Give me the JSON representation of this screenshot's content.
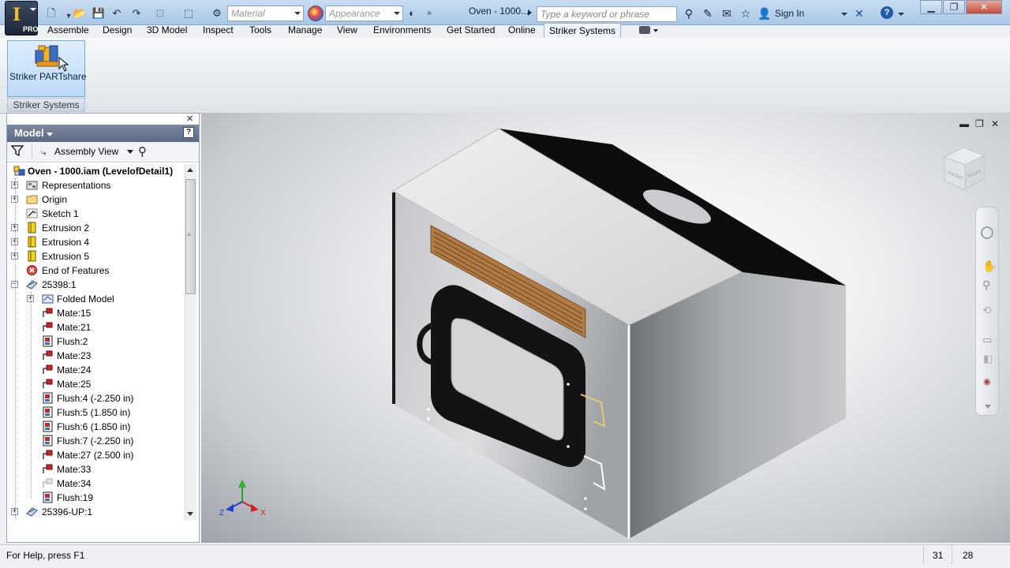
{
  "quick_access": {
    "material_placeholder": "Material",
    "appearance_placeholder": "Appearance",
    "app_pro_label": "PRO"
  },
  "titlebar": {
    "document_title": "Oven - 1000...",
    "search_placeholder": "Type a keyword or phrase",
    "sign_in": "Sign In"
  },
  "menu": {
    "items": [
      "Assemble",
      "Design",
      "3D Model",
      "Inspect",
      "Tools",
      "Manage",
      "View",
      "Environments",
      "Get Started",
      "Online",
      "Striker Systems"
    ],
    "active": "Striker Systems"
  },
  "ribbon": {
    "button_label": "Striker PARTshare",
    "panel_label": "Striker Systems"
  },
  "browser": {
    "title": "Model",
    "view_mode": "Assembly View",
    "help": "?",
    "close": "✕",
    "tree": [
      {
        "label": "Oven - 1000.iam (LevelofDetail1)",
        "level": 0,
        "expander": "",
        "icon": "assembly-icon",
        "bold": true
      },
      {
        "label": "Representations",
        "level": 1,
        "expander": "+",
        "icon": "representations-icon"
      },
      {
        "label": "Origin",
        "level": 1,
        "expander": "+",
        "icon": "folder-icon"
      },
      {
        "label": "Sketch 1",
        "level": 1,
        "expander": "",
        "icon": "sketch-icon"
      },
      {
        "label": "Extrusion 2",
        "level": 1,
        "expander": "+",
        "icon": "extrusion-icon"
      },
      {
        "label": "Extrusion 4",
        "level": 1,
        "expander": "+",
        "icon": "extrusion-icon"
      },
      {
        "label": "Extrusion 5",
        "level": 1,
        "expander": "+",
        "icon": "extrusion-icon"
      },
      {
        "label": "End of Features",
        "level": 1,
        "expander": "",
        "icon": "end-of-features-icon"
      },
      {
        "label": "25398:1",
        "level": 1,
        "expander": "−",
        "icon": "sheet-metal-part-icon"
      },
      {
        "label": "Folded Model",
        "level": 2,
        "expander": "+",
        "icon": "folded-model-icon"
      },
      {
        "label": "Mate:15",
        "level": 2,
        "expander": "",
        "icon": "mate-icon"
      },
      {
        "label": "Mate:21",
        "level": 2,
        "expander": "",
        "icon": "mate-icon"
      },
      {
        "label": "Flush:2",
        "level": 2,
        "expander": "",
        "icon": "flush-icon"
      },
      {
        "label": "Mate:23",
        "level": 2,
        "expander": "",
        "icon": "mate-icon"
      },
      {
        "label": "Mate:24",
        "level": 2,
        "expander": "",
        "icon": "mate-icon"
      },
      {
        "label": "Mate:25",
        "level": 2,
        "expander": "",
        "icon": "mate-icon"
      },
      {
        "label": "Flush:4 (-2.250 in)",
        "level": 2,
        "expander": "",
        "icon": "flush-icon"
      },
      {
        "label": "Flush:5 (1.850 in)",
        "level": 2,
        "expander": "",
        "icon": "flush-icon"
      },
      {
        "label": "Flush:6 (1.850 in)",
        "level": 2,
        "expander": "",
        "icon": "flush-icon"
      },
      {
        "label": "Flush:7 (-2.250 in)",
        "level": 2,
        "expander": "",
        "icon": "flush-icon"
      },
      {
        "label": "Mate:27 (2.500 in)",
        "level": 2,
        "expander": "",
        "icon": "mate-icon"
      },
      {
        "label": "Mate:33",
        "level": 2,
        "expander": "",
        "icon": "mate-icon"
      },
      {
        "label": "Mate:34",
        "level": 2,
        "expander": "",
        "icon": "mate-suppressed-icon"
      },
      {
        "label": "Flush:19",
        "level": 2,
        "expander": "",
        "icon": "flush-icon"
      },
      {
        "label": "25396-UP:1",
        "level": 1,
        "expander": "+",
        "icon": "sheet-metal-part-icon"
      }
    ]
  },
  "viewport": {
    "axis_labels": {
      "x": "X",
      "y": "Y",
      "z": "Z"
    },
    "viewcube_labels": {
      "front": "FRONT",
      "right": "RIGHT"
    }
  },
  "status": {
    "help_text": "For Help, press F1",
    "count1": "31",
    "count2": "28"
  },
  "colors": {
    "titlebar": "#b8d2ee",
    "active_tab": "#eef4fb",
    "model_header": "#6a788f",
    "vent": "#b07a44",
    "constraint_red": "#c0282c",
    "extrusion_yellow": "#f0d020"
  }
}
